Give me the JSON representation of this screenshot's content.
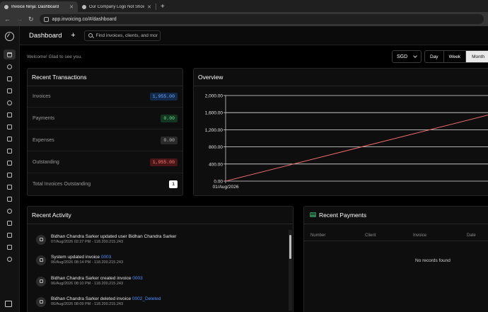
{
  "browser": {
    "tabs": [
      {
        "title": "Invoice Ninja: Dashboard",
        "active": true
      },
      {
        "title": "Our Company Logo Not Showi",
        "active": false
      }
    ],
    "url": "app.invoicing.co/#/dashboard"
  },
  "header": {
    "title": "Dashboard",
    "add_label": "+",
    "search_placeholder": "Find invoices, clients, and more"
  },
  "welcome": "Welcome! Glad to see you.",
  "currency": "SGD",
  "period": {
    "options": [
      "Day",
      "Week",
      "Month"
    ],
    "selected": "Month"
  },
  "transactions": {
    "title": "Recent Transactions",
    "rows": [
      {
        "label": "Invoices",
        "value": "1,955.00",
        "color": "blue"
      },
      {
        "label": "Payments",
        "value": "0.00",
        "color": "green"
      },
      {
        "label": "Expenses",
        "value": "0.00",
        "color": "gray"
      },
      {
        "label": "Outstanding",
        "value": "1,955.00",
        "color": "red"
      },
      {
        "label": "Total Invoices Outstanding",
        "value": "1",
        "color": "white"
      }
    ]
  },
  "overview": {
    "title": "Overview"
  },
  "chart_data": {
    "type": "line",
    "x": [
      "01/Aug/2026"
    ],
    "y_ticks": [
      "0.00",
      "400.00",
      "800.00",
      "1,200.00",
      "1,600.00",
      "2,000.00"
    ],
    "ylim": [
      0,
      2000
    ],
    "series": [
      {
        "values": [
          0,
          1560
        ],
        "color": "#e86a6a"
      }
    ],
    "grid": true
  },
  "activity": {
    "title": "Recent Activity",
    "items": [
      {
        "text": "Bidhan Chandra Sarker updated user Bidhan Chandra Sarker",
        "link": "",
        "meta": "07/Aug/2026 02:27 PM - 118.200.215.243"
      },
      {
        "text": "System updated invoice ",
        "link": "0003",
        "meta": "06/Aug/2026 08:14 PM - 118.200.215.243"
      },
      {
        "text": "Bidhan Chandra Sarker created invoice ",
        "link": "0003",
        "meta": "06/Aug/2026 08:10 PM - 118.200.215.243"
      },
      {
        "text": "Bidhan Chandra Sarker deleted invoice ",
        "link": "0002_Deleted",
        "meta": "06/Aug/2026 08:09 PM - 118.200.215.243"
      }
    ]
  },
  "payments": {
    "title": "Recent Payments",
    "columns": [
      "Number",
      "Client",
      "Invoice",
      "Date"
    ],
    "empty": "No records found"
  }
}
